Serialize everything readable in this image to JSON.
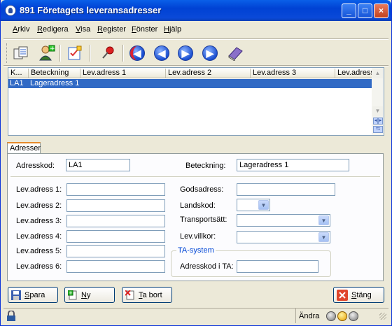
{
  "window": {
    "title": "891 Företagets leveransadresser",
    "min": "_",
    "max": "□",
    "close": "×"
  },
  "menu": [
    "Arkiv",
    "Redigera",
    "Visa",
    "Register",
    "Fönster",
    "Hjälp"
  ],
  "toolbar": [
    "list-icon",
    "add-user-icon",
    "checklist-icon",
    "pin-icon",
    "first-icon",
    "prev-icon",
    "next-icon",
    "last-icon",
    "book-icon"
  ],
  "grid": {
    "columns": [
      "K...",
      "Beteckning",
      "Lev.adress 1",
      "Lev.adress 2",
      "Lev.adress 3",
      "Lev.adress"
    ],
    "rows": [
      {
        "kod": "LA1",
        "beteckning": "Lageradress 1",
        "a1": "",
        "a2": "",
        "a3": ""
      }
    ]
  },
  "tab": "Adresser",
  "form": {
    "adresskod_label": "Adresskod:",
    "adresskod": "LA1",
    "beteckning_label": "Beteckning:",
    "beteckning": "Lageradress 1",
    "lev1_label": "Lev.adress 1:",
    "lev1": "",
    "lev2_label": "Lev.adress 2:",
    "lev2": "",
    "lev3_label": "Lev.adress 3:",
    "lev3": "",
    "lev4_label": "Lev.adress 4:",
    "lev4": "",
    "lev5_label": "Lev.adress 5:",
    "lev5": "",
    "lev6_label": "Lev.adress 6:",
    "lev6": "",
    "godsadress_label": "Godsadress:",
    "godsadress": "",
    "landskod_label": "Landskod:",
    "landskod": "",
    "transportsatt_label": "Transportsätt:",
    "transportsatt": "",
    "levvillkor_label": "Lev.villkor:",
    "levvillkor": "",
    "ta_group": "TA-system",
    "ta_label": "Adresskod i TA:",
    "ta": ""
  },
  "buttons": {
    "save": "Spara",
    "new": "Ny",
    "delete": "Ta bort",
    "close": "Stäng"
  },
  "status": {
    "mode": "Ändra"
  },
  "colors": {
    "selection": "#316ac5",
    "titlebar": "#0042d4",
    "accent_tab": "#e68b2c"
  }
}
